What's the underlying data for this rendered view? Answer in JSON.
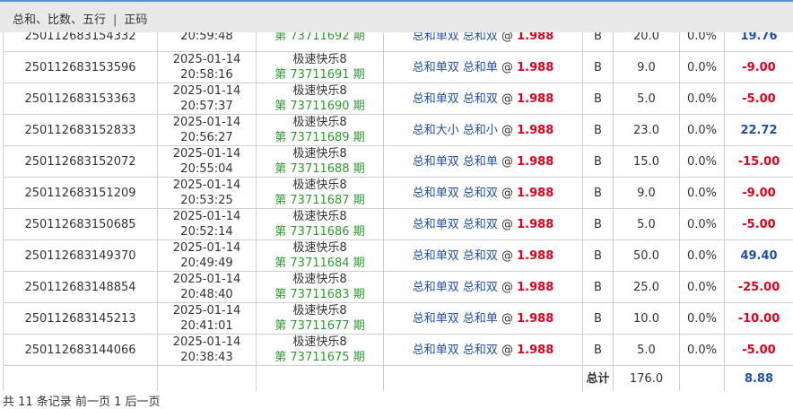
{
  "breadcrumb": {
    "item1": "总和、比数、五行",
    "separator": "|",
    "item2": "正码"
  },
  "rows": [
    {
      "id": "250112683154332",
      "date": "",
      "time": "20:59:48",
      "game": "",
      "issue": "第 73711692 期",
      "bet": "总和单双 总和双",
      "at": "@",
      "odds": "1.988",
      "side": "B",
      "amount": "20.0",
      "rebate": "0.0%",
      "win": "19.76",
      "win_sign": "pos"
    },
    {
      "id": "250112683153596",
      "date": "2025-01-14",
      "time": "20:58:16",
      "game": "极速快乐8",
      "issue": "第 73711691 期",
      "bet": "总和单双 总和单",
      "at": "@",
      "odds": "1.988",
      "side": "B",
      "amount": "9.0",
      "rebate": "0.0%",
      "win": "-9.00",
      "win_sign": "neg"
    },
    {
      "id": "250112683153363",
      "date": "2025-01-14",
      "time": "20:57:37",
      "game": "极速快乐8",
      "issue": "第 73711690 期",
      "bet": "总和单双 总和双",
      "at": "@",
      "odds": "1.988",
      "side": "B",
      "amount": "5.0",
      "rebate": "0.0%",
      "win": "-5.00",
      "win_sign": "neg"
    },
    {
      "id": "250112683152833",
      "date": "2025-01-14",
      "time": "20:56:27",
      "game": "极速快乐8",
      "issue": "第 73711689 期",
      "bet": "总和大小 总和小",
      "at": "@",
      "odds": "1.988",
      "side": "B",
      "amount": "23.0",
      "rebate": "0.0%",
      "win": "22.72",
      "win_sign": "pos"
    },
    {
      "id": "250112683152072",
      "date": "2025-01-14",
      "time": "20:55:04",
      "game": "极速快乐8",
      "issue": "第 73711688 期",
      "bet": "总和单双 总和单",
      "at": "@",
      "odds": "1.988",
      "side": "B",
      "amount": "15.0",
      "rebate": "0.0%",
      "win": "-15.00",
      "win_sign": "neg"
    },
    {
      "id": "250112683151209",
      "date": "2025-01-14",
      "time": "20:53:25",
      "game": "极速快乐8",
      "issue": "第 73711687 期",
      "bet": "总和单双 总和双",
      "at": "@",
      "odds": "1.988",
      "side": "B",
      "amount": "9.0",
      "rebate": "0.0%",
      "win": "-9.00",
      "win_sign": "neg"
    },
    {
      "id": "250112683150685",
      "date": "2025-01-14",
      "time": "20:52:14",
      "game": "极速快乐8",
      "issue": "第 73711686 期",
      "bet": "总和单双 总和双",
      "at": "@",
      "odds": "1.988",
      "side": "B",
      "amount": "5.0",
      "rebate": "0.0%",
      "win": "-5.00",
      "win_sign": "neg"
    },
    {
      "id": "250112683149370",
      "date": "2025-01-14",
      "time": "20:49:49",
      "game": "极速快乐8",
      "issue": "第 73711684 期",
      "bet": "总和单双 总和双",
      "at": "@",
      "odds": "1.988",
      "side": "B",
      "amount": "50.0",
      "rebate": "0.0%",
      "win": "49.40",
      "win_sign": "pos"
    },
    {
      "id": "250112683148854",
      "date": "2025-01-14",
      "time": "20:48:40",
      "game": "极速快乐8",
      "issue": "第 73711683 期",
      "bet": "总和单双 总和双",
      "at": "@",
      "odds": "1.988",
      "side": "B",
      "amount": "25.0",
      "rebate": "0.0%",
      "win": "-25.00",
      "win_sign": "neg"
    },
    {
      "id": "250112683145213",
      "date": "2025-01-14",
      "time": "20:41:01",
      "game": "极速快乐8",
      "issue": "第 73711677 期",
      "bet": "总和单双 总和单",
      "at": "@",
      "odds": "1.988",
      "side": "B",
      "amount": "10.0",
      "rebate": "0.0%",
      "win": "-10.00",
      "win_sign": "neg"
    },
    {
      "id": "250112683144066",
      "date": "2025-01-14",
      "time": "20:38:43",
      "game": "极速快乐8",
      "issue": "第 73711675 期",
      "bet": "总和单双 总和双",
      "at": "@",
      "odds": "1.988",
      "side": "B",
      "amount": "5.0",
      "rebate": "0.0%",
      "win": "-5.00",
      "win_sign": "neg"
    }
  ],
  "total": {
    "label": "总计",
    "amount": "176.0",
    "win": "8.88"
  },
  "footer": {
    "count_text": "共 11 条记录",
    "prev": "前一页",
    "page": "1",
    "next": "后一页"
  },
  "colors": {
    "win_positive": "#1f4fa8",
    "win_negative": "#e0001b",
    "odds": "#e0001b",
    "issue": "#2e9b2e",
    "bet": "#1f4fa8",
    "accent_top": "#5a8fd8"
  }
}
